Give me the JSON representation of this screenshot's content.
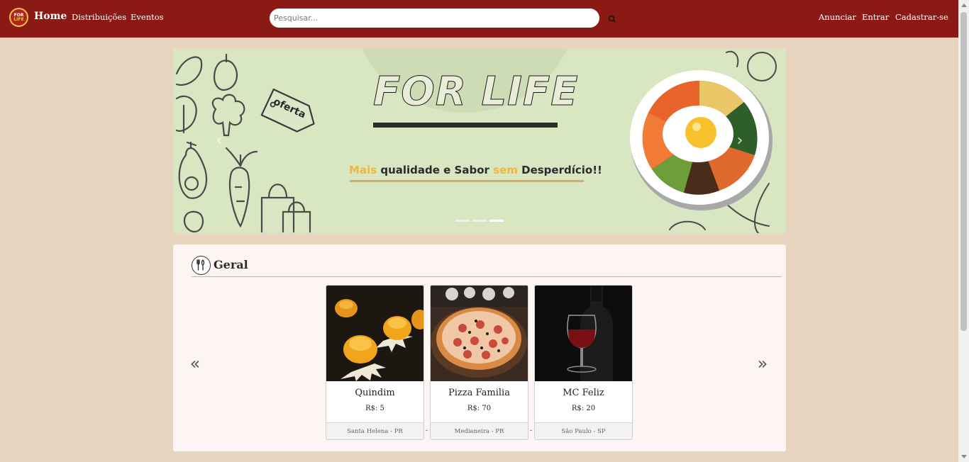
{
  "brand": {
    "logo_line1": "FOR",
    "logo_line2": "LIFE"
  },
  "nav": {
    "home": "Home",
    "links": [
      "Distribuições",
      "Eventos"
    ],
    "right_links": [
      "Anunciar",
      "Entrar",
      "Cadastrar-se"
    ]
  },
  "search": {
    "placeholder": "Pesquisar...",
    "value": "",
    "icon": "search-icon"
  },
  "banner": {
    "title": "FOR LIFE",
    "badge": "oferta",
    "tagline": {
      "word1": "Mais",
      "word2": " qualidade e Sabor ",
      "word3": "sem",
      "word4": " Desperdício!!"
    },
    "slide_count": 3,
    "active_slide": 3
  },
  "section": {
    "title": "Geral",
    "icon": "cutlery-icon",
    "prev_icon": "double-chevron-left-icon",
    "next_icon": "double-chevron-right-icon",
    "products": [
      {
        "name": "Quindim",
        "price": "R$: 5",
        "location": "Santa Helena - PR"
      },
      {
        "name": "Pizza Familia",
        "price": "R$: 70",
        "location": "Medianeira - PR"
      },
      {
        "name": "MC Feliz",
        "price": "R$: 20",
        "location": "São Paulo - SP"
      }
    ],
    "separator": "-"
  },
  "colors": {
    "navbar": "#8b1a14",
    "page_bg": "#e8d5c0",
    "banner_bg": "#d8e6c2",
    "accent_yellow": "#f0b83a"
  }
}
